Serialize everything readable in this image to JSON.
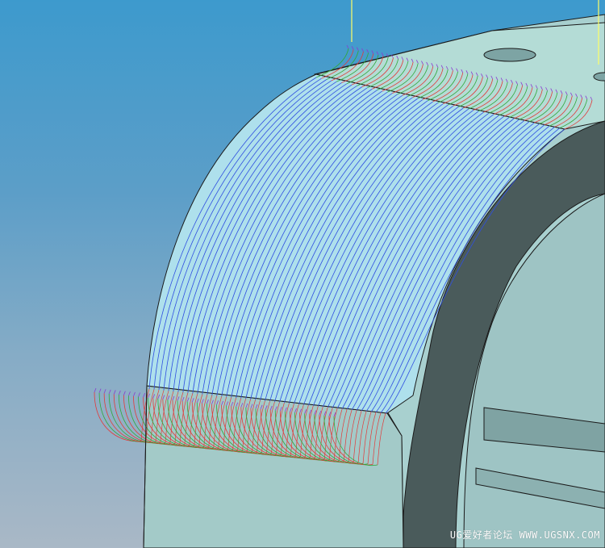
{
  "viewport": {
    "colors": {
      "background_top": "#3d9acd",
      "background_bottom": "#a9b8c6",
      "part_face": "#a8d0cf",
      "part_dark": "#4a5b5b",
      "toolpath_blue": "#2f4ee0",
      "toolpath_red": "#e23a3a",
      "toolpath_green": "#2fa83a",
      "axis_yellow": "#ffff66"
    },
    "toolpath": {
      "pass_count": 50,
      "icons": [
        "milling-toolpath-icon",
        "work-axis-icon"
      ]
    }
  },
  "watermark": {
    "text": "UG爱好者论坛 WWW.UGSNX.COM"
  }
}
